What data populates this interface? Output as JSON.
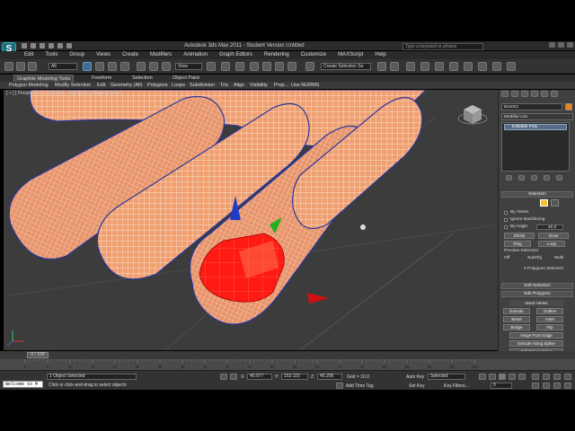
{
  "app": {
    "title": "Autodesk 3ds Max 2011 - Student Version    Untitled",
    "search_placeholder": "Type a keyword or phrase"
  },
  "menu": [
    "Edit",
    "Tools",
    "Group",
    "Views",
    "Create",
    "Modifiers",
    "Animation",
    "Graph Editors",
    "Rendering",
    "Customize",
    "MAXScript",
    "Help"
  ],
  "toolbar": {
    "selection_filter": "All",
    "reference_coord": "View",
    "named_selection": "Create Selection Se"
  },
  "ribbon": {
    "tabs": [
      "Graphite Modeling Tools",
      "Freeform",
      "Selection",
      "Object Paint"
    ],
    "active_tab": "Graphite Modeling Tools",
    "subtabs": [
      "Polygon Modeling",
      "Modify Selection",
      "Edit",
      "Geometry (All)",
      "Polygons",
      "Loops",
      "Subdivision",
      "Tris",
      "Align",
      "Visibility",
      "Prop...",
      "Use NURMS"
    ]
  },
  "viewport": {
    "label": "[ + ] [ Perspective ] [ Smooth + Highlights + Edged Faces ]"
  },
  "command_panel": {
    "object_name": "Box001",
    "modifier_list": "Modifier List",
    "stack_item": "Editable Poly",
    "selection_title": "Selection",
    "by_vertex": "By Vertex",
    "ignore_backfacing": "Ignore Backfacing",
    "by_angle": "By Angle:",
    "angle_value": "45.0",
    "shrink": "Shrink",
    "grow": "Grow",
    "ring": "Ring",
    "loop": "Loop",
    "preview_selection": "Preview Selection",
    "preview_off": "Off",
    "preview_subobj": "SubObj",
    "preview_multi": "Multi",
    "selected_info": "4 Polygons Selected",
    "soft_selection": "Soft Selection",
    "edit_polygons": "Edit Polygons",
    "insert_vertex": "Insert Vertex",
    "extrude": "Extrude",
    "outline": "Outline",
    "bevel": "Bevel",
    "inset": "Inset",
    "bridge": "Bridge",
    "flip": "Flip",
    "hinge": "Hinge From Edge",
    "extrude_spline": "Extrude Along Spline",
    "edit_triangulation": "Edit Triangulation",
    "retriangulate": "Retriangulate",
    "turn": "Turn"
  },
  "timeline": {
    "frame_counter": "0 / 100",
    "ticks": [
      "0",
      "5",
      "10",
      "15",
      "20",
      "25",
      "30",
      "35",
      "40",
      "45",
      "50",
      "55",
      "60",
      "65",
      "70",
      "75",
      "80",
      "85",
      "90",
      "95",
      "100"
    ]
  },
  "status": {
    "welcome": "Welcome to M",
    "selected": "1 Object Selected",
    "prompt": "Click or click-and-drag to select objects",
    "x_label": "X:",
    "x_value": "40.977",
    "y_label": "Y:",
    "y_value": "153.115",
    "z_label": "Z:",
    "z_value": "45.206",
    "grid": "Grid = 10.0",
    "add_time_tag": "Add Time Tag",
    "auto_key": "Auto Key",
    "key_mode": "Selected",
    "set_key": "Set Key",
    "key_filters": "Key Filters...",
    "frame": "0"
  },
  "colors": {
    "selection_red": "#ff1a12",
    "skin": "#f0a070",
    "wire_blue": "#2838a0",
    "viewport_bg": "#3c3c3c"
  }
}
